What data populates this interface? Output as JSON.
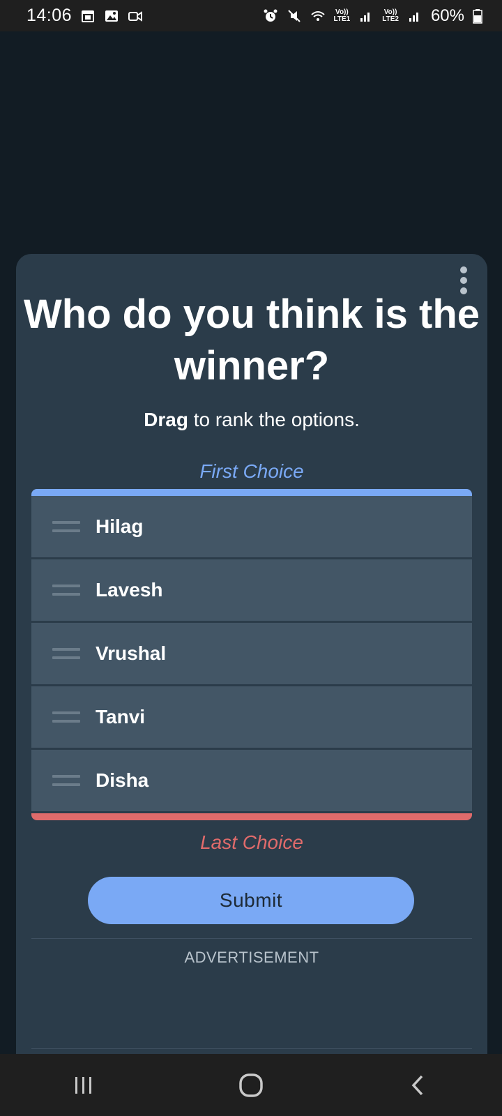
{
  "status_bar": {
    "time": "14:06",
    "lte1": "LTE1",
    "lte2": "LTE2",
    "volte1": "Vo))",
    "volte2": "Vo))",
    "battery": "60%",
    "icons": [
      "calendar-icon",
      "gallery-icon",
      "video-icon",
      "alarm-icon",
      "mute-icon",
      "wifi-icon",
      "signal-icon",
      "signal-icon",
      "battery-icon"
    ]
  },
  "poll": {
    "question": "Who do you think is the winner?",
    "instruction_bold": "Drag",
    "instruction_rest": " to rank the options.",
    "first_choice_label": "First Choice",
    "last_choice_label": "Last Choice",
    "options": [
      {
        "label": "Hilag"
      },
      {
        "label": "Lavesh"
      },
      {
        "label": "Vrushal"
      },
      {
        "label": "Tanvi"
      },
      {
        "label": "Disha"
      }
    ],
    "submit_label": "Submit",
    "ad_label": "ADVERTISEMENT"
  },
  "colors": {
    "page_bg": "#121c24",
    "card_bg": "#2b3c4a",
    "item_bg": "#435666",
    "first_accent": "#7aa9f5",
    "last_accent": "#e06b6b"
  },
  "nav_bar": {
    "icons": [
      "recent-apps-icon",
      "home-icon",
      "back-icon"
    ]
  }
}
